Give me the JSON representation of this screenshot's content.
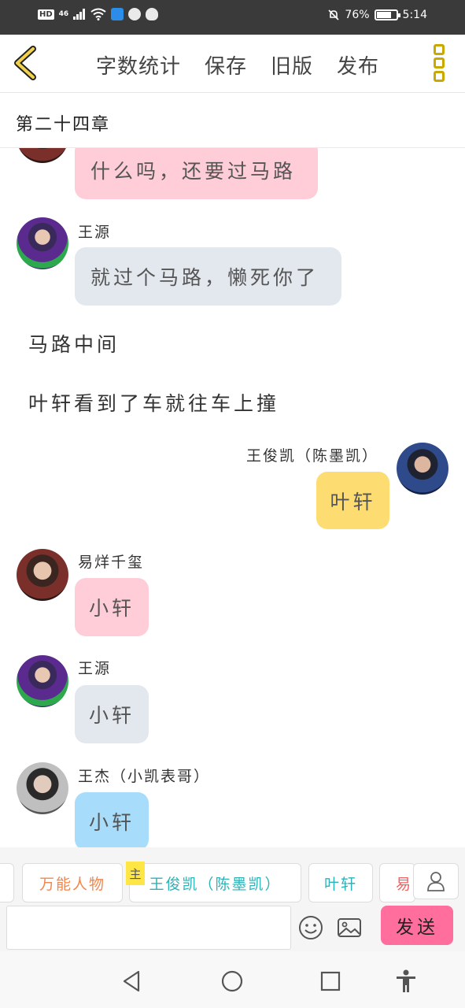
{
  "status_bar": {
    "hd": "HD",
    "network": "46",
    "battery_text": "76%",
    "battery_level": 0.76,
    "time": "5:14"
  },
  "header": {
    "actions": [
      "字数统计",
      "保存",
      "旧版",
      "发布"
    ],
    "chapter_title": "第二十四章"
  },
  "chat": {
    "messages": [
      {
        "speaker": "",
        "text": "什么吗，还要过马路",
        "side": "left",
        "color": "#fecdd8",
        "avatar": "avatar-yyqx"
      },
      {
        "speaker": "王源",
        "text": "就过个马路，懒死你了",
        "side": "left",
        "color": "#e3e7ee",
        "avatar": "avatar-wangyuan"
      },
      {
        "narration": "马路中间"
      },
      {
        "narration": "叶轩看到了车就往车上撞"
      },
      {
        "speaker": "王俊凯（陈墨凯）",
        "text": "叶轩",
        "side": "right",
        "color": "#fddd72",
        "avatar": "avatar-wangjunkai"
      },
      {
        "speaker": "易烊千玺",
        "text": "小轩",
        "side": "left",
        "color": "#fecdd8",
        "avatar": "avatar-yyqx"
      },
      {
        "speaker": "王源",
        "text": "小轩",
        "side": "left",
        "color": "#e3e7ee",
        "avatar": "avatar-wangyuan"
      },
      {
        "speaker": "王杰（小凯表哥）",
        "text": "小轩",
        "side": "left",
        "color": "#a8dcfb",
        "avatar": "avatar-wangjie"
      }
    ]
  },
  "characters": {
    "chips": [
      "万能人物",
      "王俊凯（陈墨凯）",
      "叶轩",
      "易"
    ],
    "main_tag": "主"
  },
  "input": {
    "placeholder": "",
    "value": "",
    "send_label": "发送"
  },
  "icons": {
    "back": "chevron-left-icon",
    "more": "more-vertical-icon",
    "emoji": "smiley-icon",
    "image": "image-icon",
    "person": "person-icon",
    "nav": [
      "back-triangle-icon",
      "home-circle-icon",
      "recents-square-icon",
      "accessibility-icon"
    ]
  },
  "colors": {
    "accent_yellow": "#c9a800",
    "send_pink": "#ff6e9d"
  }
}
